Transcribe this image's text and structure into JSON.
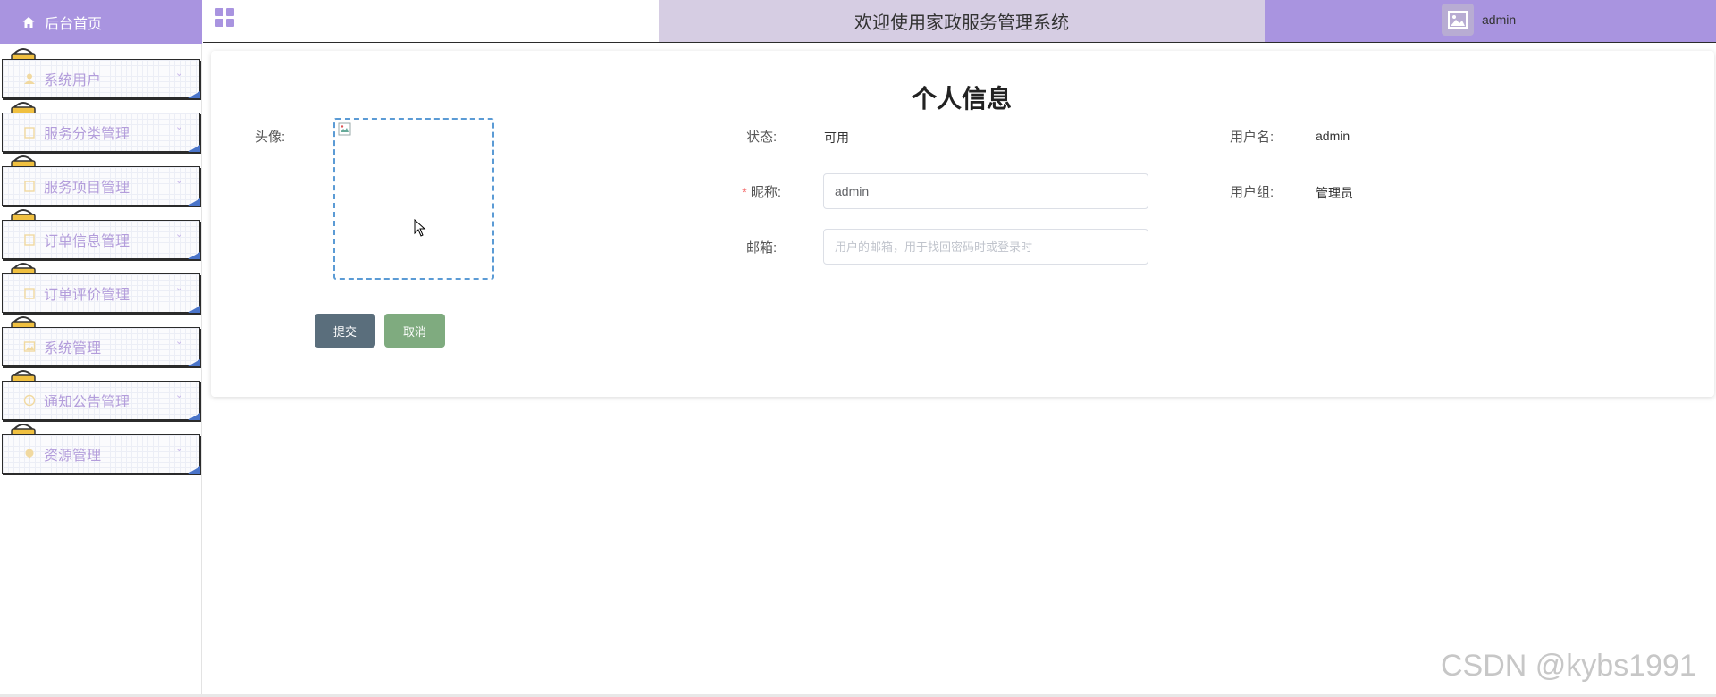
{
  "sidebar": {
    "home_label": "后台首页",
    "items": [
      {
        "label": "系统用户",
        "icon": "user-icon"
      },
      {
        "label": "服务分类管理",
        "icon": "file-icon"
      },
      {
        "label": "服务项目管理",
        "icon": "file-icon"
      },
      {
        "label": "订单信息管理",
        "icon": "file-icon"
      },
      {
        "label": "订单评价管理",
        "icon": "file-icon"
      },
      {
        "label": "系统管理",
        "icon": "image-icon"
      },
      {
        "label": "通知公告管理",
        "icon": "info-icon"
      },
      {
        "label": "资源管理",
        "icon": "pin-icon"
      }
    ]
  },
  "header": {
    "title": "欢迎使用家政服务管理系统",
    "username": "admin"
  },
  "form": {
    "page_title": "个人信息",
    "avatar_label": "头像:",
    "status_label": "状态:",
    "status_value": "可用",
    "username_label": "用户名:",
    "username_value": "admin",
    "nickname_label": "昵称:",
    "nickname_value": "admin",
    "usergroup_label": "用户组:",
    "usergroup_value": "管理员",
    "email_label": "邮箱:",
    "email_placeholder": "用户的邮箱，用于找回密码时或登录时",
    "submit_label": "提交",
    "cancel_label": "取消"
  },
  "watermark": "CSDN @kybs1991",
  "colors": {
    "accent": "#a994e0",
    "title_band": "#d6cde3",
    "submit": "#5a6e7c",
    "cancel": "#7fab7f",
    "menu_text": "#b39ddb"
  }
}
